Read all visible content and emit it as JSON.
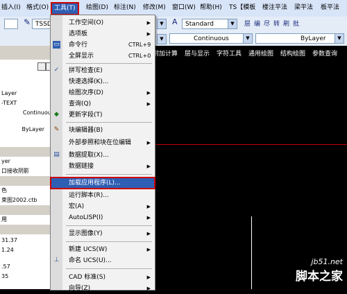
{
  "menubar": {
    "items": [
      "插入(I)",
      "格式(O)",
      "工具(T)",
      "绘图(D)",
      "标注(N)",
      "修改(M)",
      "窗口(W)",
      "帮助(H)",
      "TS【模板",
      "楼注平法",
      "梁平法",
      "板平法"
    ]
  },
  "toolbar": {
    "font_combo": "TSSD",
    "standard_combo": "Standard",
    "layer_buttons": [
      "层",
      "编",
      "尽",
      "转",
      "刷",
      "批"
    ],
    "linetype_combo": "Continuous",
    "bylayer_combo": "ByLayer"
  },
  "command_tabs": [
    "附加计算",
    "层与显示",
    "字符工具",
    "通用绘图",
    "结构绘图",
    "参数查询"
  ],
  "left_panel": {
    "rows": [
      "Layer",
      "-TEXT",
      "Continuous",
      "ByLayer",
      "yer",
      "口接收阴影",
      "色",
      "束图2002.ctb",
      "用",
      "31.37",
      "1.24",
      ".57",
      "35"
    ]
  },
  "menu": {
    "items": [
      {
        "label": "工作空间(O)",
        "shortcut": "",
        "submenu": true,
        "icon": ""
      },
      {
        "label": "选项板",
        "shortcut": "",
        "submenu": true,
        "icon": ""
      },
      {
        "label": "命令行",
        "shortcut": "CTRL+9",
        "submenu": false,
        "icon": "command-line-icon"
      },
      {
        "label": "全屏显示",
        "shortcut": "CTRL+0",
        "submenu": false,
        "icon": ""
      },
      {
        "label": "拼写检查(E)",
        "shortcut": "",
        "submenu": false,
        "icon": "spell-check-icon"
      },
      {
        "label": "快速选择(K)...",
        "shortcut": "",
        "submenu": false,
        "icon": ""
      },
      {
        "label": "绘图次序(D)",
        "shortcut": "",
        "submenu": true,
        "icon": ""
      },
      {
        "label": "查询(Q)",
        "shortcut": "",
        "submenu": true,
        "icon": ""
      },
      {
        "label": "更新字段(T)",
        "shortcut": "",
        "submenu": false,
        "icon": "update-field-icon"
      },
      {
        "label": "块编辑器(B)",
        "shortcut": "",
        "submenu": false,
        "icon": "block-editor-icon"
      },
      {
        "label": "外部参照和块在位编辑",
        "shortcut": "",
        "submenu": true,
        "icon": ""
      },
      {
        "label": "数据提取(X)...",
        "shortcut": "",
        "submenu": false,
        "icon": "data-extract-icon"
      },
      {
        "label": "数据链接",
        "shortcut": "",
        "submenu": true,
        "icon": ""
      },
      {
        "label": "加载应用程序(L)...",
        "shortcut": "",
        "submenu": false,
        "icon": ""
      },
      {
        "label": "运行脚本(R)...",
        "shortcut": "",
        "submenu": false,
        "icon": ""
      },
      {
        "label": "宏(A)",
        "shortcut": "",
        "submenu": true,
        "icon": ""
      },
      {
        "label": "AutoLISP(I)",
        "shortcut": "",
        "submenu": true,
        "icon": ""
      },
      {
        "label": "显示图像(Y)",
        "shortcut": "",
        "submenu": true,
        "icon": ""
      },
      {
        "label": "新建 UCS(W)",
        "shortcut": "",
        "submenu": true,
        "icon": ""
      },
      {
        "label": "命名 UCS(U)...",
        "shortcut": "",
        "submenu": false,
        "icon": "named-ucs-icon"
      },
      {
        "label": "CAD 标准(S)",
        "shortcut": "",
        "submenu": true,
        "icon": ""
      },
      {
        "label": "向导(Z)",
        "shortcut": "",
        "submenu": true,
        "icon": ""
      }
    ]
  },
  "watermark": {
    "site": "jb51.net",
    "name": "脚本之家"
  },
  "colors": {
    "highlight": "#2f5fb4",
    "annotation_red": "#cc0000",
    "canvas": "#000000"
  }
}
